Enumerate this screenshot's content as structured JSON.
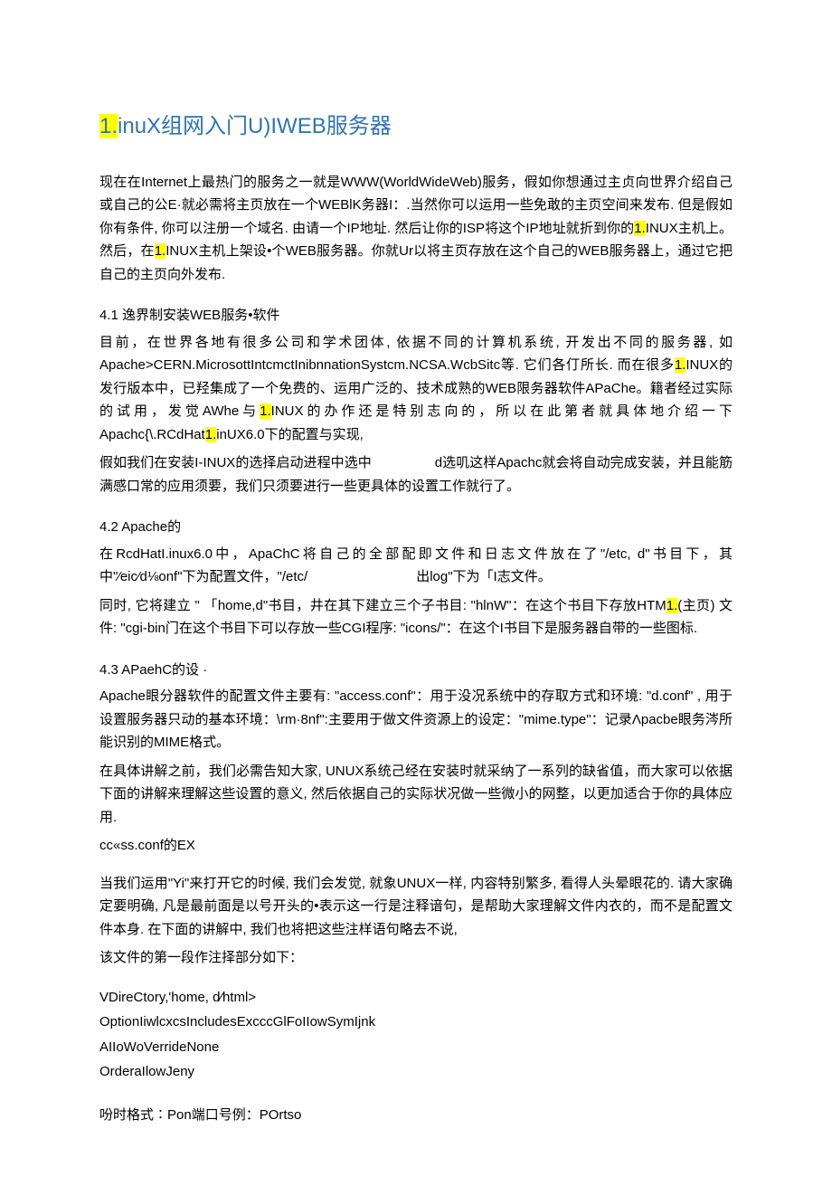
{
  "title_parts": {
    "pre": "1.",
    "rest": "inuX组网入门U)IWEB服务器"
  },
  "intro": {
    "p1a": "现在在Internet上最热门的服务之一就是WWW(WorldWideWeb)服务，假如你想通过主贞向世界介绍自己或自己的公E·就必需将主页放在一个WEBlK务器I：.当然你可以运用一些免敢的主页空间来发布. 但是假如你有条件, 你可以注册一个域名. 由请一个IP地址. 然后让你的ISP将这个IP地址就折到你的",
    "hl1": "1.",
    "p1b": "INUX主机上。然后，在",
    "hl2": "1.",
    "p1c": "INUX主机上架设•个WEB服务器。你就Ur以将主页存放在这个自己的WEB服务器上，通过它把自己的主页向外发布."
  },
  "s41": {
    "head": "4.1   逸界制安装WEB服务•软件",
    "p1a": "目前，在世界各地有很多公司和学术团体, 依据不同的计算机系统, 开发出不同的服务器, 如Apache>CERN.MicrosottIntcmctInibnnationSystcm.NCSA.WcbSitc等. 它们各仃所长. 而在很多",
    "hl1": "1.",
    "p1b": "INUX的发行版本中，已羟集成了一个免费的、运用广泛的、技术成熟的WEB限务器软件APaChe。籍者经过实际的试用，发觉AWhe与",
    "hl2": "1.",
    "p1c": "INUX的办作还是特别志向的，所以在此第者就具体地介绍一下Apachc{\\.RCdHat",
    "hl3": "1.",
    "p1d": "inUX6.0下的配置与实现,",
    "p2a": "假如我们在安装I-INUX的选择启动进程中选中",
    "p2b": "d选叽这样Apachc就会将自动完成安装，并且能筋满感口常的应用须要，我们只须要进行一些更具体的设置工作就行了。"
  },
  "s42": {
    "head": "4.2    Apache的",
    "p1a": "在RcdHatI.inux6.0中，ApaChC将自己的全部配即文件和日志文件放在了\"/etc,   d\"书目下，其中\"⁄eic⁄d⅛onf\"下为配置文件，\"/etc/",
    "p1b": "出log\"下为「I志文件。",
    "p2a": "同时, 它将建立 \" 「home,d\"书目，井在其下建立三个子书目: \"hlnW\"：在这个书目下存放HTM",
    "hl1": "1.",
    "p2b": "(主页) 文件: \"cgi-bin门在这个书目下可以存放一些CGI程序: \"icons/\"：在这个I书目下是服务器自带的一些图标."
  },
  "s43": {
    "head": "4.3    APaehC的设 ·",
    "p1": "Apache眼分器软件的配置文件主要有: \"access.conf\"：用于没况系统中的存取方式和环境: \"d.conf\" , 用于设置服务器只动的基本环境：\\rm·8nf\":主要用于做文件资源上的设定：\"mime.type\"：记录Λpacbe眼务涔所能识别的MIME格式。",
    "p2": "在具体讲解之前，我们必需告知大家, UNUX系统己经在安装时就采纳了一系列的缺省值，而大家可以依据下面的讲解来理解这些设置的意义, 然后依据自己的实际状况做一些微小的网整，以更加适合于你的具体应用.",
    "p3": "cc«ss.conf的EX",
    "p4": "当我们运用\"Yi\"来打开它的时候, 我们会发觉, 就象UNUX一样, 内容特别繁多, 看得人头晕眼花的. 请大家确定要明确, 凡是最前面是以号开头的•表示这一行是注释谙句，是帮助大家理解文件内衣的，而不是配置文件本身. 在下面的讲解中, 我们也将把这些注样语句略去不说,",
    "p5": "该文件的第一段作注择部分如下：",
    "c1": "VDireCtory,'home,       d⁄html>",
    "c2": "OptionIiwlcxcsIncludesExcccGlFoIIowSymIjnk",
    "c3": "AIIoWoVerrideNone",
    "c4": "OrderaIlowJeny",
    "p6": "吩时格式∶Pon端口号例：POrtso"
  }
}
